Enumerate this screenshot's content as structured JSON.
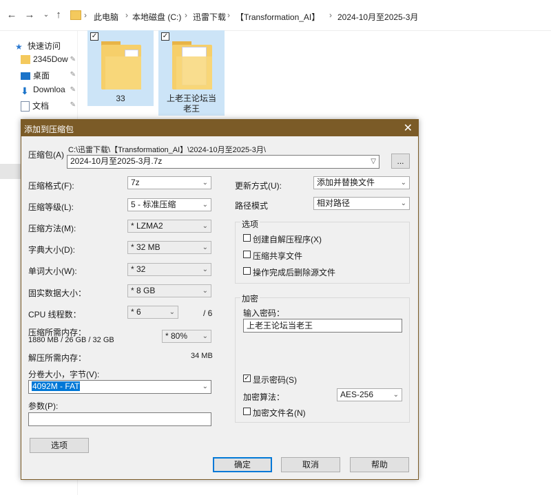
{
  "address": {
    "crumbs": [
      "此电脑",
      "本地磁盘 (C:)",
      "迅雷下载",
      "【Transformation_AI】",
      "2024-10月至2025-3月"
    ]
  },
  "sidebar": {
    "quick_access": "快速访问",
    "items": [
      {
        "label": "2345Dow",
        "icon": "folder-icon"
      },
      {
        "label": "桌面",
        "icon": "desktop-icon"
      },
      {
        "label": "Downloa",
        "icon": "download-icon"
      },
      {
        "label": "文档",
        "icon": "document-icon"
      }
    ]
  },
  "files": [
    {
      "name": "33"
    },
    {
      "name": "上老王论坛当老王"
    }
  ],
  "dialog": {
    "title": "添加到压缩包",
    "archive_label": "压缩包(A)",
    "archive_path": "C:\\迅雷下载\\【Transformation_AI】\\2024-10月至2025-3月\\",
    "archive_name": "2024-10月至2025-3月.7z",
    "browse_label": "...",
    "format_label": "压缩格式(F):",
    "format_value": "7z",
    "level_label": "压缩等级(L):",
    "level_value": "5 - 标准压缩",
    "method_label": "压缩方法(M):",
    "method_value": "* LZMA2",
    "dict_label": "字典大小(D):",
    "dict_value": "* 32 MB",
    "word_label": "单词大小(W):",
    "word_value": "* 32",
    "solid_label": "固实数据大小：",
    "solid_value": "* 8 GB",
    "cpu_label": "CPU 线程数：",
    "cpu_value": "* 6",
    "cpu_max": "/ 6",
    "mem_label": "压缩所需内存：",
    "mem_detail": "1880 MB / 26 GB / 32 GB",
    "mem_value": "* 80%",
    "decomp_label": "解压所需内存：",
    "decomp_value": "34 MB",
    "split_label": "分卷大小，字节(V):",
    "split_value": "4092M - FAT",
    "params_label": "参数(P):",
    "params_value": "",
    "options_button": "选项",
    "update_label": "更新方式(U):",
    "update_value": "添加并替换文件",
    "path_label": "路径模式",
    "path_value": "相对路径",
    "options_group": "选项",
    "opt_sfx": "创建自解压程序(X)",
    "opt_shared": "压缩共享文件",
    "opt_delete": "操作完成后删除源文件",
    "encrypt_group": "加密",
    "password_label": "输入密码：",
    "password_value": "上老王论坛当老王",
    "show_password": "显示密码(S)",
    "enc_method_label": "加密算法：",
    "enc_method_value": "AES-256",
    "enc_names": "加密文件名(N)",
    "ok": "确定",
    "cancel": "取消",
    "help": "帮助"
  }
}
